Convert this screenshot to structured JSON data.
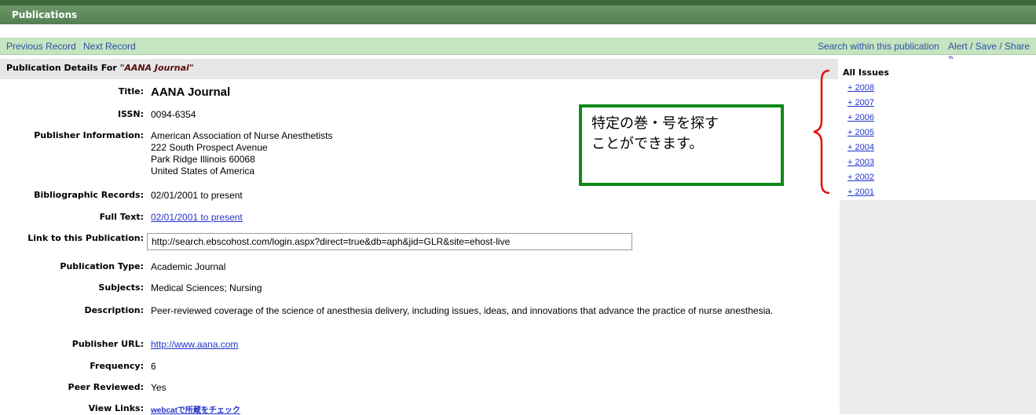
{
  "header": {
    "title": "Publications"
  },
  "nav": {
    "previous": "Previous Record",
    "next": "Next Record",
    "search_within": "Search within this publication",
    "alert_save_share": "Alert / Save / Share »"
  },
  "details": {
    "header_label": "Publication Details For",
    "header_title": "\"AANA Journal\"",
    "fields": {
      "title_label": "Title:",
      "title_value": "AANA Journal",
      "issn_label": "ISSN:",
      "issn_value": "0094-6354",
      "publisher_label": "Publisher Information:",
      "publisher_lines": [
        "American Association of Nurse Anesthetists",
        "222 South Prospect Avenue",
        "Park Ridge Illinois 60068",
        "United States of America"
      ],
      "biblio_label": "Bibliographic Records:",
      "biblio_value": "02/01/2001 to present",
      "fulltext_label": "Full Text:",
      "fulltext_value": "02/01/2001 to present",
      "link_label": "Link to this Publication:",
      "link_value": "http://search.ebscohost.com/login.aspx?direct=true&db=aph&jid=GLR&site=ehost-live",
      "pubtype_label": "Publication Type:",
      "pubtype_value": "Academic Journal",
      "subjects_label": "Subjects:",
      "subjects_value": "Medical Sciences; Nursing",
      "description_label": "Description:",
      "description_value": "Peer-reviewed coverage of the science of anesthesia delivery, including issues, ideas, and innovations that advance the practice of nurse anesthesia.",
      "url_label": "Publisher URL:",
      "url_value": "http://www.aana.com",
      "frequency_label": "Frequency:",
      "frequency_value": "6",
      "peer_label": "Peer Reviewed:",
      "peer_value": "Yes",
      "viewlinks_label": "View Links:",
      "viewlinks_value": "webcatで所蔵をチェック"
    }
  },
  "sidebar": {
    "heading": "All Issues",
    "issues": [
      "+ 2008",
      "+ 2007",
      "+ 2006",
      "+ 2005",
      "+ 2004",
      "+ 2003",
      "+ 2002",
      "+ 2001"
    ]
  },
  "callout": {
    "line1": "特定の巻・号を探す",
    "line2": "ことができます。"
  },
  "colors": {
    "header_bar": "#5f8a5c",
    "nav_bar": "#c5e4c0",
    "link": "#2233cc",
    "callout_border": "#0f8a1a",
    "brace": "#e01010"
  }
}
